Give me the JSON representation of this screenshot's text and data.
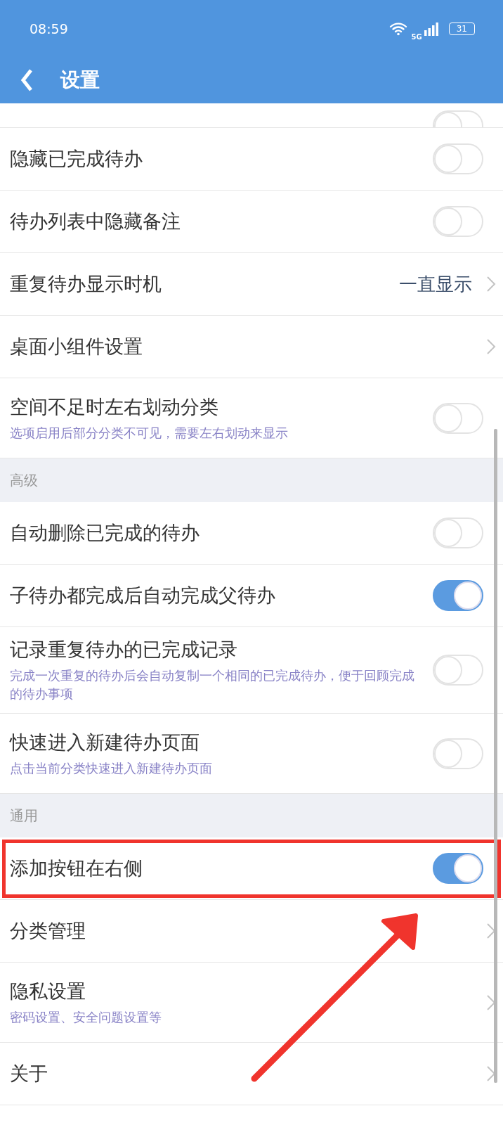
{
  "status_bar": {
    "time": "08:59",
    "network": "5G",
    "battery": "31"
  },
  "header": {
    "title": "设置"
  },
  "items": [
    {
      "kind": "toggle",
      "on": false,
      "partial": true,
      "highlighted": false
    },
    {
      "kind": "toggle",
      "label": "隐藏已完成待办",
      "on": false,
      "highlighted": false
    },
    {
      "kind": "toggle",
      "label": "待办列表中隐藏备注",
      "on": false,
      "highlighted": false
    },
    {
      "kind": "nav",
      "label": "重复待办显示时机",
      "value": "一直显示",
      "highlighted": false
    },
    {
      "kind": "nav",
      "label": "桌面小组件设置",
      "highlighted": false
    },
    {
      "kind": "toggle",
      "label": "空间不足时左右划动分类",
      "subtitle": "选项启用后部分分类不可见，需要左右划动来显示",
      "on": false,
      "highlighted": false
    },
    {
      "kind": "section",
      "label": "高级"
    },
    {
      "kind": "toggle",
      "label": "自动删除已完成的待办",
      "on": false,
      "highlighted": false
    },
    {
      "kind": "toggle",
      "label": "子待办都完成后自动完成父待办",
      "on": true,
      "highlighted": false
    },
    {
      "kind": "toggle",
      "label": "记录重复待办的已完成记录",
      "subtitle": "完成一次重复的待办后会自动复制一个相同的已完成待办，便于回顾完成的待办事项",
      "on": false,
      "highlighted": false
    },
    {
      "kind": "toggle",
      "label": "快速进入新建待办页面",
      "subtitle": "点击当前分类快速进入新建待办页面",
      "on": false,
      "highlighted": false
    },
    {
      "kind": "section",
      "label": "通用"
    },
    {
      "kind": "toggle",
      "label": "添加按钮在右侧",
      "on": true,
      "highlighted": true
    },
    {
      "kind": "nav",
      "label": "分类管理",
      "highlighted": false
    },
    {
      "kind": "nav",
      "label": "隐私设置",
      "subtitle": "密码设置、安全问题设置等",
      "highlighted": false
    },
    {
      "kind": "nav",
      "label": "关于",
      "highlighted": false
    }
  ]
}
